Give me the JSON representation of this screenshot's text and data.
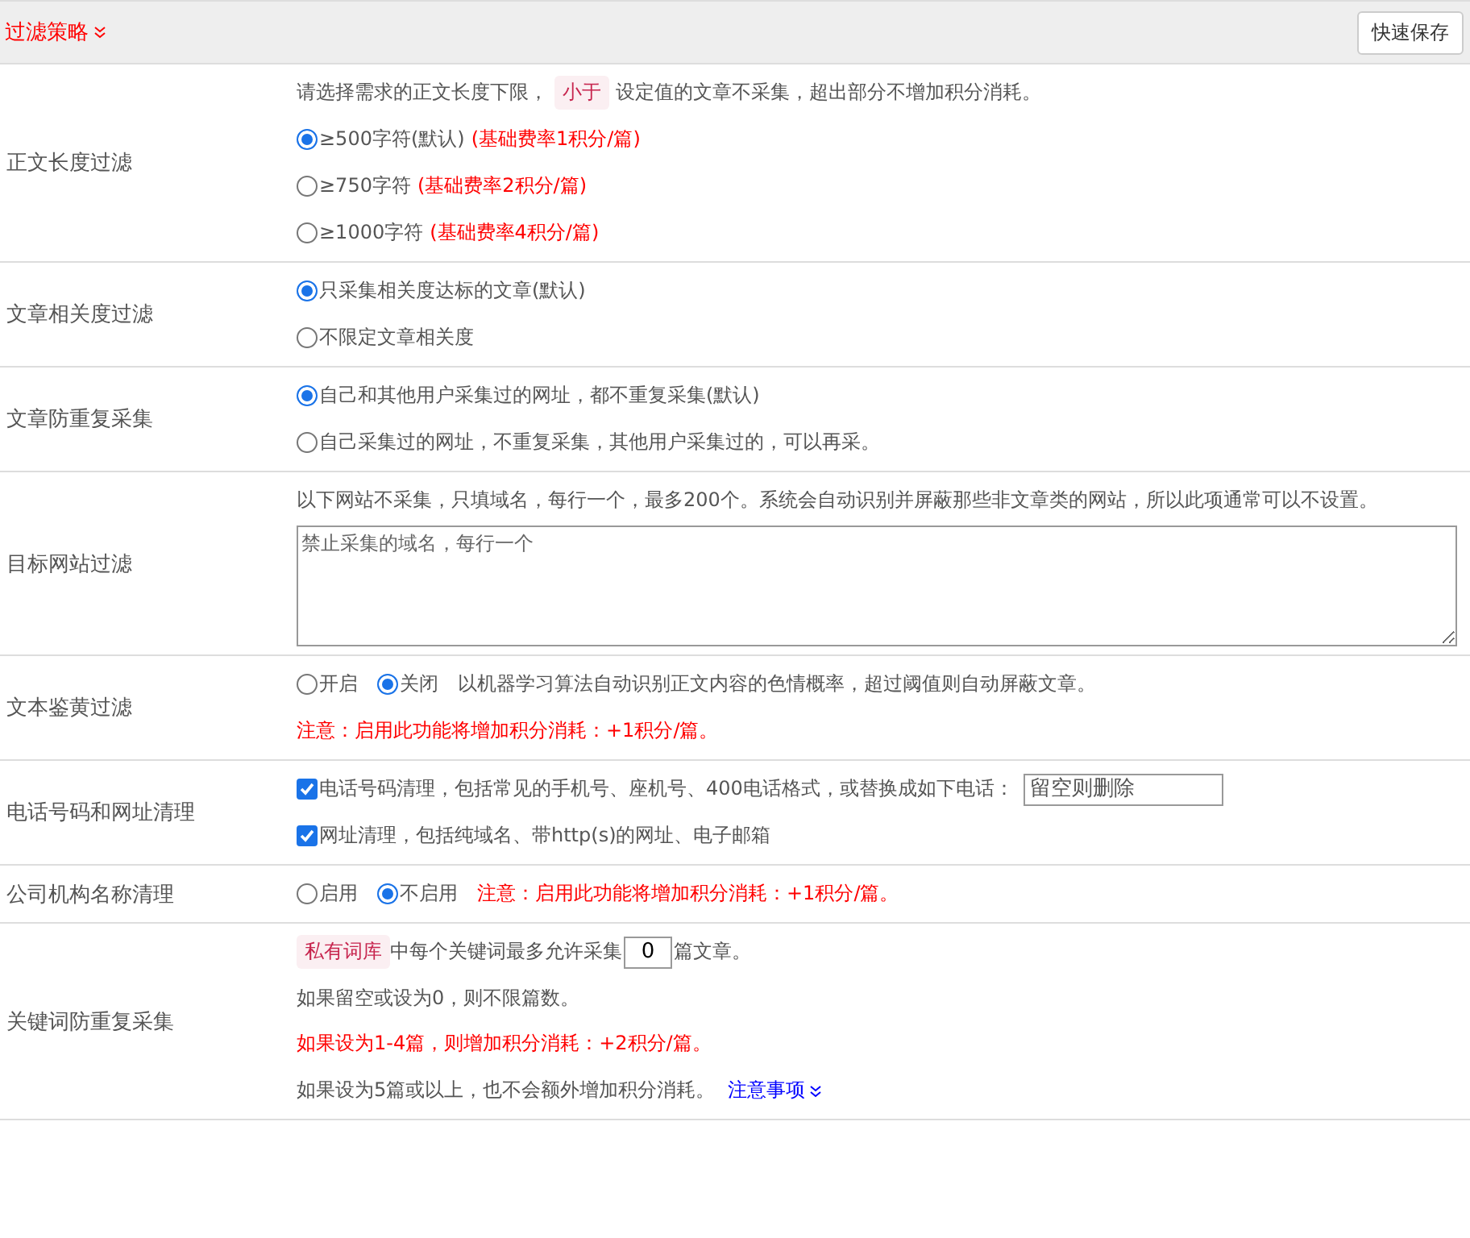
{
  "header": {
    "title": "过滤策略",
    "save_button": "快速保存"
  },
  "rows": [
    {
      "label": "正文长度过滤",
      "lines": [
        {
          "kind": "text",
          "parts": [
            {
              "kind": "plain",
              "text": "请选择需求的正文长度下限，"
            },
            {
              "kind": "tag",
              "text": "小于"
            },
            {
              "kind": "plain",
              "text": "设定值的文章不采集，超出部分不增加积分消耗。"
            }
          ]
        },
        {
          "kind": "radio",
          "label": "≥500字符(默认)",
          "selected": true,
          "note": "(基础费率1积分/篇)"
        },
        {
          "kind": "radio",
          "label": "≥750字符",
          "selected": false,
          "note": "(基础费率2积分/篇)"
        },
        {
          "kind": "radio",
          "label": "≥1000字符",
          "selected": false,
          "note": "(基础费率4积分/篇)"
        }
      ]
    },
    {
      "label": "文章相关度过滤",
      "lines": [
        {
          "kind": "radio",
          "label": "只采集相关度达标的文章(默认)",
          "selected": true
        },
        {
          "kind": "radio",
          "label": "不限定文章相关度",
          "selected": false
        }
      ]
    },
    {
      "label": "文章防重复采集",
      "lines": [
        {
          "kind": "radio",
          "label": "自己和其他用户采集过的网址，都不重复采集(默认)",
          "selected": true
        },
        {
          "kind": "radio",
          "label": "自己采集过的网址，不重复采集，其他用户采集过的，可以再采。",
          "selected": false
        }
      ]
    },
    {
      "label": "目标网站过滤",
      "lines": [
        {
          "kind": "text",
          "parts": [
            {
              "kind": "plain",
              "text": "以下网站不采集，只填域名，每行一个，最多200个。系统会自动识别并屏蔽那些非文章类的网站，所以此项通常可以不设置。"
            }
          ]
        },
        {
          "kind": "textarea",
          "placeholder": "禁止采集的域名，每行一个"
        }
      ]
    },
    {
      "label": "文本鉴黄过滤",
      "lines": [
        {
          "kind": "radios",
          "options": [
            {
              "label": "开启",
              "selected": false
            },
            {
              "label": "关闭",
              "selected": true
            }
          ],
          "parts": [
            {
              "kind": "plain",
              "text": "以机器学习算法自动识别正文内容的色情概率，超过阈值则自动屏蔽文章。"
            }
          ]
        },
        {
          "kind": "text",
          "parts": [
            {
              "kind": "warn",
              "text": "注意：启用此功能将增加积分消耗：+1积分/篇。"
            }
          ]
        }
      ]
    },
    {
      "label": "电话号码和网址清理",
      "lines": [
        {
          "kind": "checkbox",
          "label": "电话号码清理，包括常见的手机号、座机号、400电话格式，或替换成如下电话：",
          "checked": true,
          "placeholder": "留空则删除"
        },
        {
          "kind": "checkbox",
          "label": "网址清理，包括纯域名、带http(s)的网址、电子邮箱",
          "checked": true
        }
      ]
    },
    {
      "label": "公司机构名称清理",
      "lines": [
        {
          "kind": "radios",
          "options": [
            {
              "label": "启用",
              "selected": false
            },
            {
              "label": "不启用",
              "selected": true
            }
          ],
          "parts": [
            {
              "kind": "warn",
              "text": "注意：启用此功能将增加积分消耗：+1积分/篇。"
            }
          ]
        }
      ]
    },
    {
      "label": "关键词防重复采集",
      "lines": [
        {
          "kind": "counter",
          "tag": "私有词库",
          "text": "中每个关键词最多允许采集",
          "value": "0",
          "suffix": "篇文章。"
        },
        {
          "kind": "text",
          "parts": [
            {
              "kind": "plain",
              "text": "如果留空或设为0，则不限篇数。"
            }
          ]
        },
        {
          "kind": "text",
          "parts": [
            {
              "kind": "warn",
              "text": "如果设为1-4篇，则增加积分消耗：+2积分/篇。"
            }
          ]
        },
        {
          "kind": "text",
          "parts": [
            {
              "kind": "plain",
              "text": "如果设为5篇或以上，也不会额外增加积分消耗。"
            },
            {
              "kind": "link",
              "text": "注意事项"
            }
          ]
        }
      ]
    }
  ]
}
